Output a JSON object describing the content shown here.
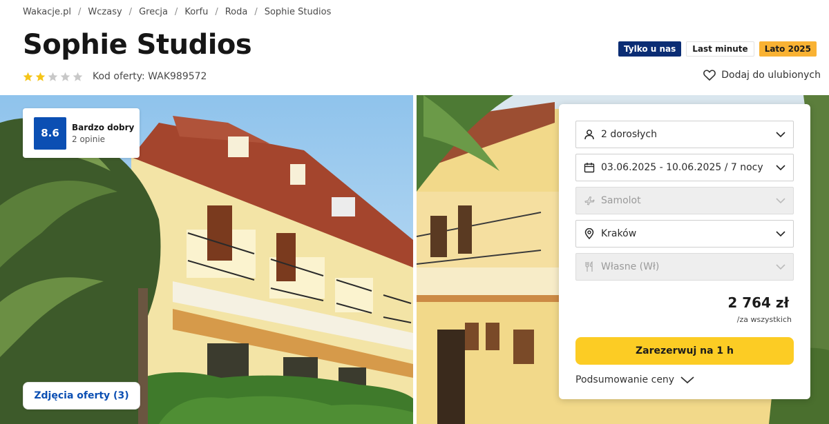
{
  "breadcrumb": [
    "Wakacje.pl",
    "Wczasy",
    "Grecja",
    "Korfu",
    "Roda",
    "Sophie Studios"
  ],
  "breadcrumb_separator": "/",
  "title": "Sophie Studios",
  "rating": {
    "stars": 2,
    "max": 5,
    "filled_color": "#f5c518",
    "empty_color": "#c8c8c8"
  },
  "offer_code": "Kod oferty: WAK989572",
  "badges": [
    "Tylko u nas",
    "Last minute",
    "Lato 2025"
  ],
  "favorite_label": "Dodaj do ulubionych",
  "score": {
    "value": "8.6",
    "label": "Bardzo dobry",
    "count": "2 opinie"
  },
  "photos_button": "Zdjęcia oferty (3)",
  "booking": {
    "travelers": "2 dorosłych",
    "dates": "03.06.2025 - 10.06.2025 / 7 nocy",
    "transport": "Samolot",
    "departure": "Kraków",
    "board": "Własne (Wł)",
    "price": "2 764 zł",
    "price_note": "/za wszystkich",
    "book_label": "Zarezerwuj na 1 h",
    "summary_label": "Podsumowanie ceny"
  },
  "colors": {
    "accent_blue": "#0b4fb3",
    "navy": "#0b2d74",
    "cta_yellow": "#fccc24",
    "badge_orange": "#f9b233"
  }
}
